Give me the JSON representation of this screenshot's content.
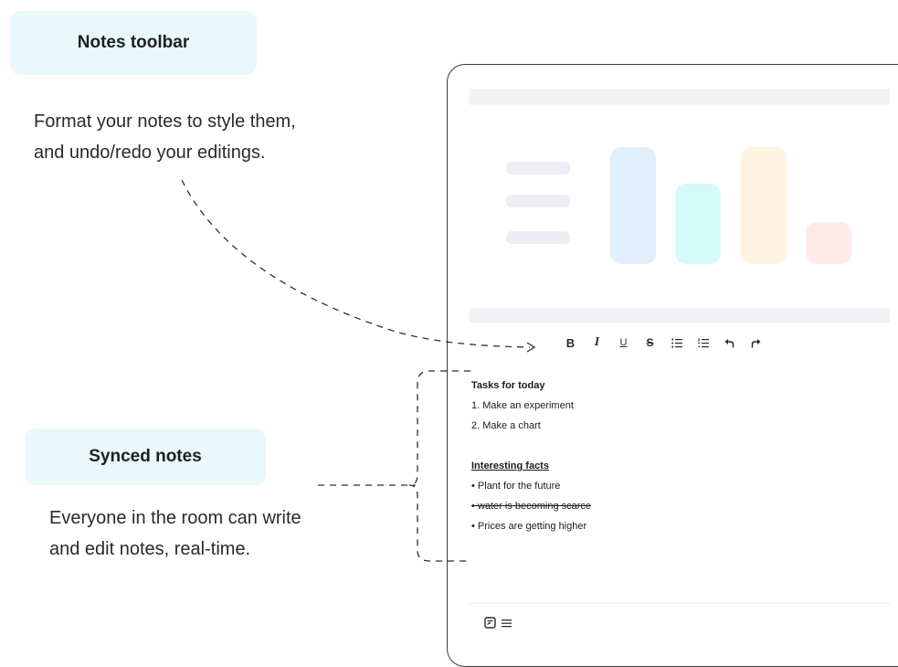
{
  "callouts": {
    "toolbar": {
      "title": "Notes toolbar",
      "description_line1": "Format your notes to style them,",
      "description_line2": "and undo/redo your editings."
    },
    "synced": {
      "title": "Synced notes",
      "description_line1": "Everyone in the room can write",
      "description_line2": "and edit notes, real-time."
    }
  },
  "toolbar": {
    "bold_label": "B",
    "italic_label": "I",
    "underline_label": "U",
    "strike_label": "S",
    "icons": [
      "bold-icon",
      "italic-icon",
      "underline-icon",
      "strikethrough-icon",
      "bullet-list-icon",
      "numbered-list-icon",
      "undo-icon",
      "redo-icon"
    ]
  },
  "notes": {
    "tasks_heading": "Tasks for today",
    "tasks": [
      "1.  Make an experiment",
      "2.  Make a chart"
    ],
    "facts_heading": "Interesting facts",
    "facts": [
      "• Plant for the future",
      "• water is becoming scarce",
      "• Prices are getting higher"
    ]
  },
  "chart_preview": {
    "bar_colors": [
      "#e1eefc",
      "#d6faf7",
      "#fff4e2",
      "#fdebeb"
    ]
  },
  "footer": {
    "icons": [
      "notes-icon",
      "menu-icon"
    ]
  }
}
